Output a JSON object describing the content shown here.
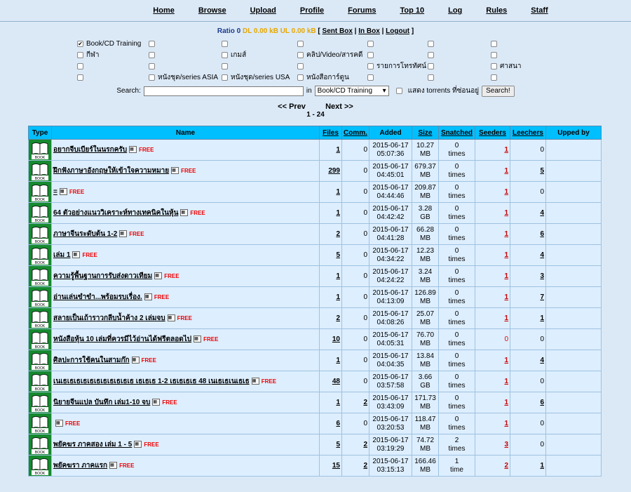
{
  "nav": [
    "Home",
    "Browse",
    "Upload",
    "Profile",
    "Forums",
    "Top 10",
    "Log",
    "Rules",
    "Staff"
  ],
  "ratio": {
    "ratio_label": "Ratio 0",
    "dl_label": "DL 0.00 kB",
    "ul_label": "UL 0.00 kB",
    "sent_box": "Sent Box",
    "in_box": "In Box",
    "logout": "Logout"
  },
  "categories": [
    {
      "label": "Book/CD Training",
      "checked": true
    },
    {
      "label": "",
      "checked": false
    },
    {
      "label": "",
      "checked": false
    },
    {
      "label": "",
      "checked": false
    },
    {
      "label": "",
      "checked": false
    },
    {
      "label": "",
      "checked": false
    },
    {
      "label": "",
      "checked": false
    },
    {
      "label": "กีฬา",
      "checked": false
    },
    {
      "label": "",
      "checked": false
    },
    {
      "label": "เกมส์",
      "checked": false
    },
    {
      "label": "คลิป/Video/สารคดี",
      "checked": false
    },
    {
      "label": "",
      "checked": false
    },
    {
      "label": "",
      "checked": false
    },
    {
      "label": "",
      "checked": false
    },
    {
      "label": "",
      "checked": false
    },
    {
      "label": "",
      "checked": false
    },
    {
      "label": "",
      "checked": false
    },
    {
      "label": "",
      "checked": false
    },
    {
      "label": "รายการโทรทัศน์",
      "checked": false
    },
    {
      "label": "",
      "checked": false
    },
    {
      "label": "ศาสนา",
      "checked": false
    },
    {
      "label": "",
      "checked": false
    },
    {
      "label": "หนังชุด/series ASIA",
      "checked": false
    },
    {
      "label": "หนังชุด/series USA",
      "checked": false
    },
    {
      "label": "หนังสือการ์ตูน",
      "checked": false
    },
    {
      "label": "",
      "checked": false
    },
    {
      "label": "",
      "checked": false
    },
    {
      "label": "",
      "checked": false
    }
  ],
  "search": {
    "label": "Search:",
    "value": "",
    "in_label": "in",
    "category_selected": "Book/CD Training",
    "hidden_label": "แสดง torrents ที่ซ่อนอยู่",
    "button": "Search!"
  },
  "pager": {
    "prev": "<< Prev",
    "next": "Next >>",
    "range": "1 - 24"
  },
  "table": {
    "headers": [
      "Type",
      "Name",
      "Files",
      "Comm.",
      "Added",
      "Size",
      "Snatched",
      "Seeders",
      "Leechers",
      "Upped by"
    ],
    "rows": [
      {
        "name": "อยากจีบเบียร์ในนรกครับ",
        "files": "1",
        "comm": "0",
        "date": "2015-06-17",
        "time": "05:07:36",
        "size1": "10.27",
        "size2": "MB",
        "snatched": "0",
        "snat_unit": "times",
        "seed": "1",
        "leech": "0"
      },
      {
        "name": "ฝึกฟังภาษาอังกฤษให้เข้าใจความหมาย",
        "files": "299",
        "comm": "0",
        "date": "2015-06-17",
        "time": "04:45:01",
        "size1": "679.37",
        "size2": "MB",
        "snatched": "0",
        "snat_unit": "times",
        "seed": "1",
        "leech": "5"
      },
      {
        "name": "=",
        "files": "1",
        "comm": "0",
        "date": "2015-06-17",
        "time": "04:44:46",
        "size1": "209.87",
        "size2": "MB",
        "snatched": "0",
        "snat_unit": "times",
        "seed": "1",
        "leech": "0"
      },
      {
        "name": "64 ตัวอย่างแนววิเคราะห์ทางเทคนิคในหุ้น",
        "files": "1",
        "comm": "0",
        "date": "2015-06-17",
        "time": "04:42:42",
        "size1": "3.28",
        "size2": "GB",
        "snatched": "0",
        "snat_unit": "times",
        "seed": "1",
        "leech": "4"
      },
      {
        "name": "ภาษาจีนระดับต้น 1-2",
        "files": "2",
        "comm": "0",
        "date": "2015-06-17",
        "time": "04:41:28",
        "size1": "66.28",
        "size2": "MB",
        "snatched": "0",
        "snat_unit": "times",
        "seed": "1",
        "leech": "6"
      },
      {
        "name": "เล่ม 1",
        "files": "5",
        "comm": "0",
        "date": "2015-06-17",
        "time": "04:34:22",
        "size1": "12.23",
        "size2": "MB",
        "snatched": "0",
        "snat_unit": "times",
        "seed": "1",
        "leech": "4"
      },
      {
        "name": "ความรู้พื้นฐานการรับส่งดาวเทียม",
        "files": "1",
        "comm": "0",
        "date": "2015-06-17",
        "time": "04:24:22",
        "size1": "3.24",
        "size2": "MB",
        "snatched": "0",
        "snat_unit": "times",
        "seed": "1",
        "leech": "3"
      },
      {
        "name": "อ่านเล่นขำขำ...พร้อมรบเรื่อง.",
        "files": "1",
        "comm": "0",
        "date": "2015-06-17",
        "time": "04:13:09",
        "size1": "126.89",
        "size2": "MB",
        "snatched": "0",
        "snat_unit": "times",
        "seed": "1",
        "leech": "7"
      },
      {
        "name": "สลายเป็นเถ้าราวกลีบน้ำค้าง 2 เล่มจบ",
        "files": "2",
        "comm": "0",
        "date": "2015-06-17",
        "time": "04:08:26",
        "size1": "25.07",
        "size2": "MB",
        "snatched": "0",
        "snat_unit": "times",
        "seed": "1",
        "leech": "1"
      },
      {
        "name": "หนังสือหุ้น 10 เล่มที่ควรมีไว้อ่านได้ฟรีตลอดไป",
        "files": "10",
        "comm": "0",
        "date": "2015-06-17",
        "time": "04:05:31",
        "size1": "76.70",
        "size2": "MB",
        "snatched": "0",
        "snat_unit": "times",
        "seed": "0",
        "leech": "0"
      },
      {
        "name": "ศิลปะการใช้คนในสามก๊ก",
        "files": "1",
        "comm": "0",
        "date": "2015-06-17",
        "time": "04:04:35",
        "size1": "13.84",
        "size2": "MB",
        "snatched": "0",
        "snat_unit": "times",
        "seed": "1",
        "leech": "4"
      },
      {
        "name": "เนเธเธเธเธเธเธเธเธเธเธเธ เธเธเธ 1-2 เธเธเธเธ 48 เนเธเธเนเธเธ",
        "files": "48",
        "comm": "0",
        "date": "2015-06-17",
        "time": "03:57:58",
        "size1": "3.66",
        "size2": "GB",
        "snatched": "0",
        "snat_unit": "times",
        "seed": "1",
        "leech": "0"
      },
      {
        "name": "นิยายจีนแปล บันทึก เล่ม1-10 จบ",
        "files": "1",
        "comm": "2",
        "date": "2015-06-17",
        "time": "03:43:09",
        "size1": "171.73",
        "size2": "MB",
        "snatched": "0",
        "snat_unit": "times",
        "seed": "1",
        "leech": "6"
      },
      {
        "name": "",
        "files": "6",
        "comm": "0",
        "date": "2015-06-17",
        "time": "03:20:53",
        "size1": "118.47",
        "size2": "MB",
        "snatched": "0",
        "snat_unit": "times",
        "seed": "1",
        "leech": "0"
      },
      {
        "name": "พยัคฆร ภาคสอง เล่ม 1 - 5",
        "files": "5",
        "comm": "2",
        "date": "2015-06-17",
        "time": "03:19:29",
        "size1": "74.72",
        "size2": "MB",
        "snatched": "2",
        "snat_unit": "times",
        "seed": "3",
        "leech": "0"
      },
      {
        "name": "พยัคฆรา ภาคแรก",
        "files": "15",
        "comm": "2",
        "date": "2015-06-17",
        "time": "03:15:13",
        "size1": "166.46",
        "size2": "MB",
        "snatched": "1",
        "snat_unit": "time",
        "seed": "2",
        "leech": "1"
      }
    ],
    "book_label": "BOOK",
    "free_label": "FREE"
  },
  "colors": {
    "header_bg": "#00bfff",
    "page_bg": "#dbe9f7",
    "type_bg": "#168a2e",
    "free": "#e00000"
  }
}
